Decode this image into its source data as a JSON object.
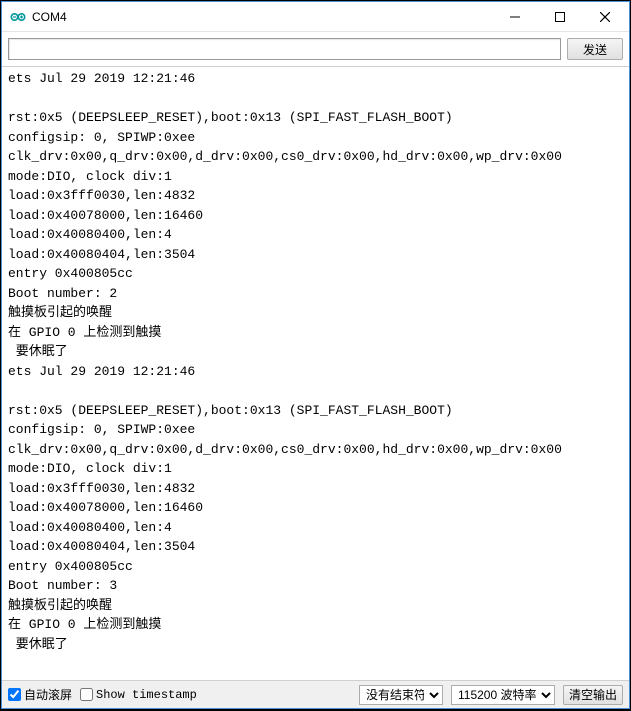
{
  "window": {
    "title": "COM4"
  },
  "toolbar": {
    "input_value": "",
    "send_label": "发送"
  },
  "console": {
    "text": "ets Jul 29 2019 12:21:46\n\nrst:0x5 (DEEPSLEEP_RESET),boot:0x13 (SPI_FAST_FLASH_BOOT)\nconfigsip: 0, SPIWP:0xee\nclk_drv:0x00,q_drv:0x00,d_drv:0x00,cs0_drv:0x00,hd_drv:0x00,wp_drv:0x00\nmode:DIO, clock div:1\nload:0x3fff0030,len:4832\nload:0x40078000,len:16460\nload:0x40080400,len:4\nload:0x40080404,len:3504\nentry 0x400805cc\nBoot number: 2\n触摸板引起的唤醒\n在 GPIO 0 上检测到触摸\n 要休眠了\nets Jul 29 2019 12:21:46\n\nrst:0x5 (DEEPSLEEP_RESET),boot:0x13 (SPI_FAST_FLASH_BOOT)\nconfigsip: 0, SPIWP:0xee\nclk_drv:0x00,q_drv:0x00,d_drv:0x00,cs0_drv:0x00,hd_drv:0x00,wp_drv:0x00\nmode:DIO, clock div:1\nload:0x3fff0030,len:4832\nload:0x40078000,len:16460\nload:0x40080400,len:4\nload:0x40080404,len:3504\nentry 0x400805cc\nBoot number: 3\n触摸板引起的唤醒\n在 GPIO 0 上检测到触摸\n 要休眠了"
  },
  "footer": {
    "autoscroll_label": "自动滚屏",
    "autoscroll_checked": true,
    "timestamp_label": "Show timestamp",
    "timestamp_checked": false,
    "line_ending_selected": "没有结束符",
    "baud_selected": "115200 波特率",
    "clear_label": "清空输出"
  }
}
